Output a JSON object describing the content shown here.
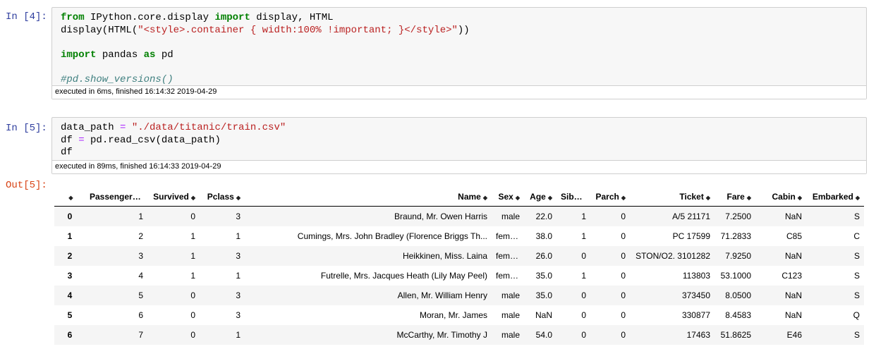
{
  "cells": [
    {
      "prompt": "In [4]:",
      "lines": [
        [
          {
            "t": "kw",
            "v": "from"
          },
          {
            "t": "",
            "v": " IPython.core.display "
          },
          {
            "t": "kw",
            "v": "import"
          },
          {
            "t": "",
            "v": " display, HTML"
          }
        ],
        [
          {
            "t": "",
            "v": "display(HTML("
          },
          {
            "t": "str",
            "v": "\"<style>.container { width:100% !important; }</style>\""
          },
          {
            "t": "",
            "v": "))"
          }
        ],
        [],
        [
          {
            "t": "kw",
            "v": "import"
          },
          {
            "t": "",
            "v": " pandas "
          },
          {
            "t": "kw",
            "v": "as"
          },
          {
            "t": "",
            "v": " pd"
          }
        ],
        [],
        [
          {
            "t": "comment",
            "v": "#pd.show_versions()"
          }
        ]
      ],
      "exec_info": "executed in 6ms, finished 16:14:32 2019-04-29"
    },
    {
      "prompt": "In [5]:",
      "lines": [
        [
          {
            "t": "",
            "v": "data_path "
          },
          {
            "t": "op",
            "v": "="
          },
          {
            "t": "",
            "v": " "
          },
          {
            "t": "str",
            "v": "\"./data/titanic/train.csv\""
          }
        ],
        [
          {
            "t": "",
            "v": "df "
          },
          {
            "t": "op",
            "v": "="
          },
          {
            "t": "",
            "v": " pd.read_csv(data_path)"
          }
        ],
        [
          {
            "t": "",
            "v": "df"
          }
        ]
      ],
      "exec_info": "executed in 89ms, finished 16:14:33 2019-04-29"
    }
  ],
  "output": {
    "prompt": "Out[5]:",
    "columns": [
      "",
      "PassengerId",
      "Survived",
      "Pclass",
      "Name",
      "Sex",
      "Age",
      "SibSp",
      "Parch",
      "Ticket",
      "Fare",
      "Cabin",
      "Embarked"
    ],
    "rows": [
      [
        "0",
        "1",
        "0",
        "3",
        "Braund, Mr. Owen Harris",
        "male",
        "22.0",
        "1",
        "0",
        "A/5 21171",
        "7.2500",
        "NaN",
        "S"
      ],
      [
        "1",
        "2",
        "1",
        "1",
        "Cumings, Mrs. John Bradley (Florence Briggs Th...",
        "female",
        "38.0",
        "1",
        "0",
        "PC 17599",
        "71.2833",
        "C85",
        "C"
      ],
      [
        "2",
        "3",
        "1",
        "3",
        "Heikkinen, Miss. Laina",
        "female",
        "26.0",
        "0",
        "0",
        "STON/O2. 3101282",
        "7.9250",
        "NaN",
        "S"
      ],
      [
        "3",
        "4",
        "1",
        "1",
        "Futrelle, Mrs. Jacques Heath (Lily May Peel)",
        "female",
        "35.0",
        "1",
        "0",
        "113803",
        "53.1000",
        "C123",
        "S"
      ],
      [
        "4",
        "5",
        "0",
        "3",
        "Allen, Mr. William Henry",
        "male",
        "35.0",
        "0",
        "0",
        "373450",
        "8.0500",
        "NaN",
        "S"
      ],
      [
        "5",
        "6",
        "0",
        "3",
        "Moran, Mr. James",
        "male",
        "NaN",
        "0",
        "0",
        "330877",
        "8.4583",
        "NaN",
        "Q"
      ],
      [
        "6",
        "7",
        "0",
        "1",
        "McCarthy, Mr. Timothy J",
        "male",
        "54.0",
        "0",
        "0",
        "17463",
        "51.8625",
        "E46",
        "S"
      ]
    ]
  }
}
